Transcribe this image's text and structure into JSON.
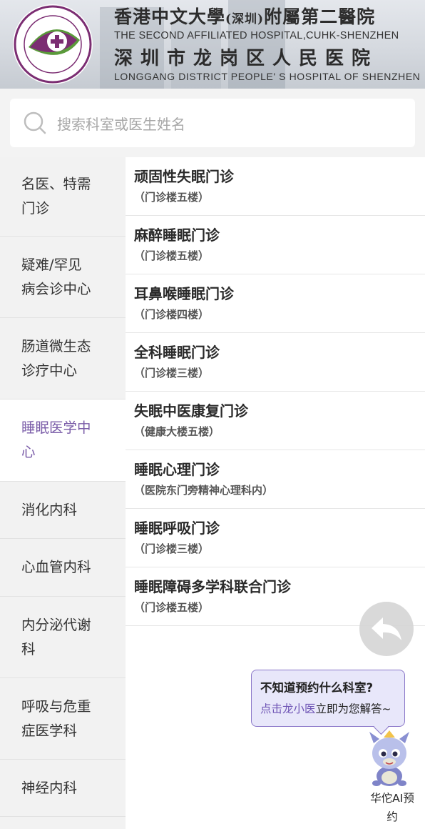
{
  "header": {
    "title_cn_line1": "香港中文大學",
    "title_cn_paren": "(深圳)",
    "title_cn_line1b": "附屬第二醫院",
    "title_en_line1": "THE SECOND AFFILIATED HOSPITAL,CUHK-SHENZHEN",
    "title_cn_line2": "深圳市龙岗区人民医院",
    "title_en_line2": "LONGGANG DISTRICT PEOPLE' S HOSPITAL OF SHENZHEN",
    "logo_text": "深圳市龙岗区人民医院",
    "logo_arc_text": "香港中文大學(深圳)附屬第二醫院"
  },
  "search": {
    "placeholder": "搜索科室或医生姓名",
    "icon": "search-icon"
  },
  "sidebar": {
    "items": [
      {
        "line1": "名医、特需",
        "line2": "门诊",
        "active": false
      },
      {
        "line1": "疑难/罕见",
        "line2": "病会诊中心",
        "active": false
      },
      {
        "line1": "肠道微生态",
        "line2": "诊疗中心",
        "active": false
      },
      {
        "line1": "睡眠医学中",
        "line2": "心",
        "active": true
      },
      {
        "line1": "消化内科",
        "line2": "",
        "active": false
      },
      {
        "line1": "心血管内科",
        "line2": "",
        "active": false
      },
      {
        "line1": "内分泌代谢",
        "line2": "科",
        "active": false
      },
      {
        "line1": "呼吸与危重",
        "line2": "症医学科",
        "active": false
      },
      {
        "line1": "神经内科",
        "line2": "",
        "active": false
      }
    ]
  },
  "clinics": [
    {
      "name": "顽固性失眠门诊",
      "location": "（门诊楼五楼）"
    },
    {
      "name": "麻醉睡眠门诊",
      "location": "（门诊楼五楼）"
    },
    {
      "name": "耳鼻喉睡眠门诊",
      "location": "（门诊楼四楼）"
    },
    {
      "name": "全科睡眠门诊",
      "location": "（门诊楼三楼）"
    },
    {
      "name": "失眠中医康复门诊",
      "location": "（健康大楼五楼）"
    },
    {
      "name": "睡眠心理门诊",
      "location": "（医院东门旁精神心理科内）"
    },
    {
      "name": "睡眠呼吸门诊",
      "location": "（门诊楼三楼）"
    },
    {
      "name": "睡眠障碍多学科联合门诊",
      "location": "（门诊楼五楼）"
    }
  ],
  "assistant": {
    "question": "不知道预约什么科室?",
    "answer_link": "点击龙小医",
    "answer_rest": "立即为您解答~",
    "label_line1": "华佗AI预",
    "label_line2": "约"
  },
  "colors": {
    "accent": "#7a5ca8",
    "logo_purple": "#7b2d72",
    "logo_green": "#5a9a3a"
  }
}
